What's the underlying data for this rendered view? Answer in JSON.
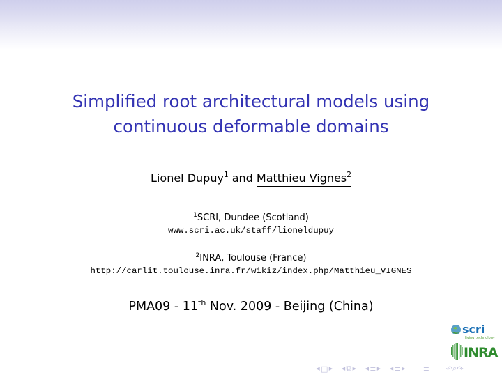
{
  "slide": {
    "title_line1": "Simplified root architectural models using",
    "title_line2": "continuous deformable domains",
    "authors": [
      {
        "name": "Lionel Dupuy",
        "affil_mark": "1",
        "presenter": false
      },
      {
        "name": "Matthieu Vignes",
        "affil_mark": "2",
        "presenter": true
      }
    ],
    "authors_joiner": "and",
    "affiliations": [
      {
        "mark": "1",
        "institution": "SCRI, Dundee (Scotland)",
        "url": "www.scri.ac.uk/staff/lioneldupuy"
      },
      {
        "mark": "2",
        "institution": "INRA, Toulouse (France)",
        "url": "http://carlit.toulouse.inra.fr/wikiz/index.php/Matthieu_VIGNES"
      }
    ],
    "event": {
      "prefix": "PMA09 - 11",
      "ordinal": "th",
      "suffix": " Nov. 2009 - Beijing (China)"
    },
    "logos": {
      "scri_text": "scri",
      "scri_tagline": "living technology",
      "inra_text": "INRA"
    }
  },
  "navigation": {
    "icons": [
      "frame-back",
      "frame-icon",
      "frame-forward",
      "subsection-back",
      "subsection-icon",
      "subsection-forward",
      "section-back",
      "section-icon",
      "section-forward",
      "presentation-back",
      "presentation-icon",
      "presentation-forward",
      "toc-icon",
      "undo-icon",
      "search-icon",
      "redo-icon"
    ]
  },
  "colors": {
    "title": "#3333b3",
    "header_gradient_top": "#cfcfec",
    "nav_icons": "#c0c0dc"
  }
}
